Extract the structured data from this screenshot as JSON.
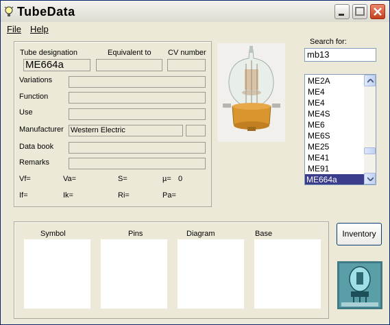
{
  "window": {
    "title": "TubeData",
    "app_icon": "lightbulb-icon",
    "controls": [
      "minimize-icon",
      "maximize-icon",
      "close-icon"
    ]
  },
  "menu": [
    "File",
    "Help"
  ],
  "tube_info": {
    "designation_label": "Tube designation",
    "equivalent_label": "Equivalent to",
    "cv_label": "CV number",
    "designation_value": "ME664a",
    "equivalent_value": "",
    "cv_value": "",
    "variations_label": "Variations",
    "function_label": "Function",
    "use_label": "Use",
    "manufacturer_label": "Manufacturer",
    "manufacturer_value": "Western Electric",
    "databook_label": "Data book",
    "remarks_label": "Remarks"
  },
  "params": {
    "vf": "Vf=",
    "va": "Va=",
    "s": "S=",
    "mu": "µ=",
    "mu_value": "0",
    "if": "If=",
    "ik": "Ik=",
    "ri": "Ri=",
    "pa": "Pa="
  },
  "search": {
    "label": "Search for:",
    "value": "mb13"
  },
  "tube_list": {
    "items": [
      "ME2A",
      "ME4",
      "ME4",
      "ME4S",
      "ME6",
      "ME6S",
      "ME25",
      "ME41",
      "ME91",
      "ME664a"
    ],
    "selected": "ME664a"
  },
  "drawings": {
    "symbol_label": "Symbol",
    "pins_label": "Pins",
    "diagram_label": "Diagram",
    "base_label": "Base"
  },
  "inventory_button": "Inventory",
  "colors": {
    "window_bg": "#ece9d8",
    "selection": "#3c3c8c",
    "close_button": "#d0502a"
  }
}
